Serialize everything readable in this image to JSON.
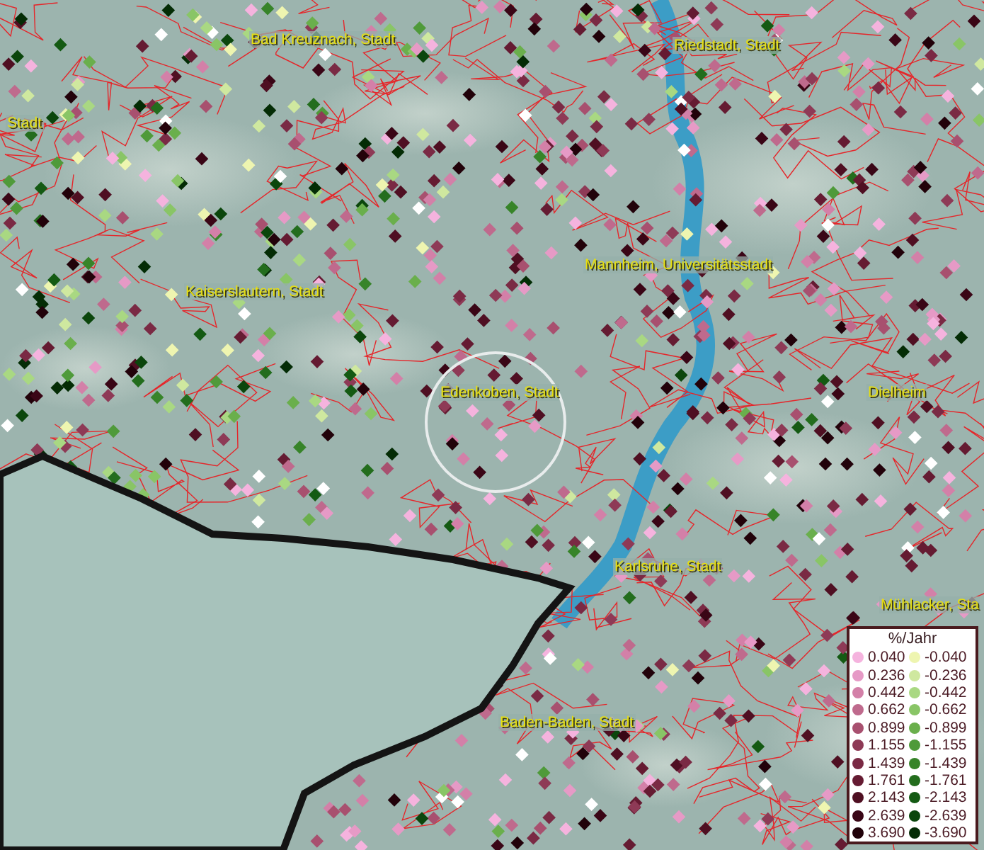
{
  "map": {
    "places": [
      {
        "name": "Bad Kreuznach, Stadt"
      },
      {
        "name": "Stadt"
      },
      {
        "name": "Riedstadt, Stadt"
      },
      {
        "name": "Kaiserslautern, Stadt"
      },
      {
        "name": "Mannheim, Universitätsstadt"
      },
      {
        "name": "Edenkoben, Stadt"
      },
      {
        "name": "Dielheim"
      },
      {
        "name": "Karlsruhe, Stadt"
      },
      {
        "name": "Mühlacker, Sta"
      },
      {
        "name": "Baden-Baden, Stadt"
      }
    ]
  },
  "legend": {
    "title": "%/Jahr",
    "positive": [
      {
        "value": "0.040",
        "color": "#f5b3de"
      },
      {
        "value": "0.236",
        "color": "#e69ac6"
      },
      {
        "value": "0.442",
        "color": "#d380a8"
      },
      {
        "value": "0.662",
        "color": "#bf6a8d"
      },
      {
        "value": "0.899",
        "color": "#a8506f"
      },
      {
        "value": "1.155",
        "color": "#8e3a56"
      },
      {
        "value": "1.439",
        "color": "#7a2a44"
      },
      {
        "value": "1.761",
        "color": "#651b32"
      },
      {
        "value": "2.143",
        "color": "#4f0f22"
      },
      {
        "value": "2.639",
        "color": "#3a0616"
      },
      {
        "value": "3.690",
        "color": "#22020a"
      }
    ],
    "negative": [
      {
        "value": "-0.040",
        "color": "#eef5b0"
      },
      {
        "value": "-0.236",
        "color": "#cfe89f"
      },
      {
        "value": "-0.442",
        "color": "#a9d882"
      },
      {
        "value": "-0.662",
        "color": "#89c566"
      },
      {
        "value": "-0.899",
        "color": "#6aaf4c"
      },
      {
        "value": "-1.155",
        "color": "#4f9a3a"
      },
      {
        "value": "-1.439",
        "color": "#378429"
      },
      {
        "value": "-1.761",
        "color": "#236d1d"
      },
      {
        "value": "-2.143",
        "color": "#145a13"
      },
      {
        "value": "-2.639",
        "color": "#0b460c"
      },
      {
        "value": "-3.690",
        "color": "#042c05"
      }
    ]
  }
}
